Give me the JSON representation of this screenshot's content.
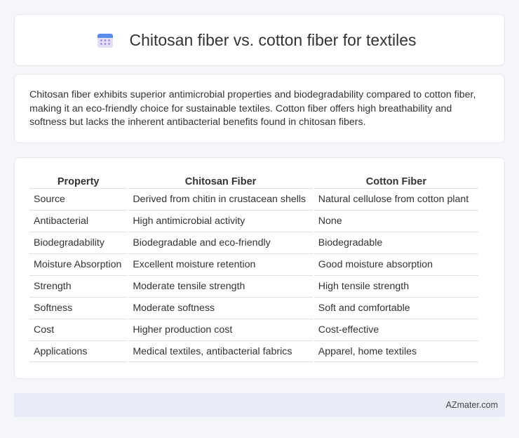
{
  "header": {
    "title": "Chitosan fiber vs. cotton fiber for textiles",
    "icon": "calendar-icon"
  },
  "summary": {
    "text": "Chitosan fiber exhibits superior antimicrobial properties and biodegradability compared to cotton fiber, making it an eco-friendly choice for sustainable textiles. Cotton fiber offers high breathability and softness but lacks the inherent antibacterial benefits found in chitosan fibers."
  },
  "table": {
    "headers": [
      "Property",
      "Chitosan Fiber",
      "Cotton Fiber"
    ],
    "rows": [
      [
        "Source",
        "Derived from chitin in crustacean shells",
        "Natural cellulose from cotton plant"
      ],
      [
        "Antibacterial",
        "High antimicrobial activity",
        "None"
      ],
      [
        "Biodegradability",
        "Biodegradable and eco-friendly",
        "Biodegradable"
      ],
      [
        "Moisture Absorption",
        "Excellent moisture retention",
        "Good moisture absorption"
      ],
      [
        "Strength",
        "Moderate tensile strength",
        "High tensile strength"
      ],
      [
        "Softness",
        "Moderate softness",
        "Soft and comfortable"
      ],
      [
        "Cost",
        "Higher production cost",
        "Cost-effective"
      ],
      [
        "Applications",
        "Medical textiles, antibacterial fabrics",
        "Apparel, home textiles"
      ]
    ]
  },
  "footer": {
    "brand": "AZmater.com"
  },
  "colors": {
    "background": "#f4f6fa",
    "card": "#ffffff",
    "footer": "#e8edf7",
    "icon_blue": "#5b8def",
    "icon_purple": "#b08ad8"
  }
}
